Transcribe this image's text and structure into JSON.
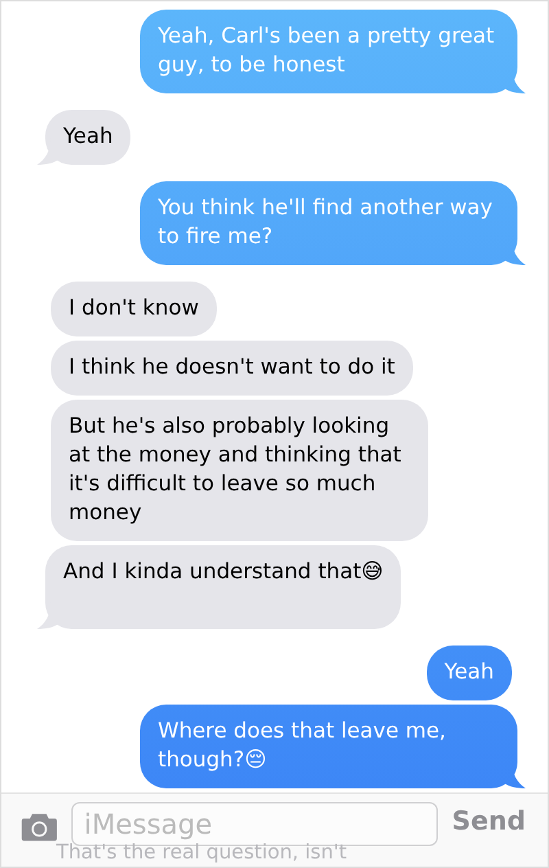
{
  "messages": [
    {
      "kind": "sent",
      "text": "Yeah, Carl's been a pretty great guy, to be honest",
      "tail": true
    },
    {
      "kind": "received",
      "text": "Yeah",
      "tail": true
    },
    {
      "kind": "sent",
      "text": "You think he'll find another way to fire me?",
      "tail": true
    },
    {
      "kind": "received",
      "text": "I don't know",
      "tail": false
    },
    {
      "kind": "received",
      "text": "I think he doesn't want to do it",
      "tail": false
    },
    {
      "kind": "received",
      "text": "But he's also probably looking at the money and thinking that it's difficult to leave so much money",
      "tail": false
    },
    {
      "kind": "received",
      "text": "And I kinda understand that😅",
      "tail": true
    },
    {
      "kind": "sent",
      "text": "Yeah",
      "tail": false
    },
    {
      "kind": "sent",
      "text": "Where does that leave me, though?😔",
      "tail": true
    },
    {
      "kind": "received",
      "text": "That's the real question, isn't"
    }
  ],
  "input_bar": {
    "placeholder": "iMessage",
    "send": "Send"
  }
}
